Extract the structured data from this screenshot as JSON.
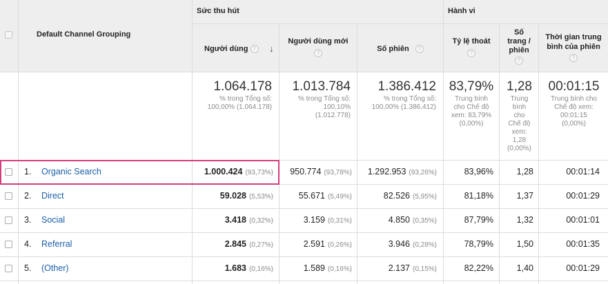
{
  "header": {
    "dimension_label": "Default Channel Grouping",
    "group_acquisition": "Sức thu hút",
    "group_behavior": "Hành vi",
    "help_glyph": "?",
    "sort_glyph": "↓",
    "columns": {
      "users": "Người dùng",
      "new_users": "Người dùng mới",
      "sessions": "Số phiên",
      "bounce_rate": "Tỷ lệ thoát",
      "pages_per_session_l1": "Số",
      "pages_per_session_l2": "trang /",
      "pages_per_session_l3": "phiên",
      "avg_duration_l1": "Thời gian trung",
      "avg_duration_l2": "bình của phiên"
    }
  },
  "totals": {
    "users": {
      "value": "1.064.178",
      "sub1": "% trong Tổng số:",
      "sub2": "100,00% (1.064.178)"
    },
    "new_users": {
      "value": "1.013.784",
      "sub1": "% trong Tổng số:",
      "sub2": "100,10%",
      "sub3": "(1.012.778)"
    },
    "sessions": {
      "value": "1.386.412",
      "sub1": "% trong Tổng số:",
      "sub2": "100,00% (1.386.412)"
    },
    "bounce_rate": {
      "value": "83,79%",
      "sub1": "Trung bình",
      "sub2": "cho Chế độ",
      "sub3": "xem: 83,79%",
      "sub4": "(0,00%)"
    },
    "pages_per_session": {
      "value": "1,28",
      "sub1": "Trung",
      "sub2": "bình",
      "sub3": "cho",
      "sub4": "Chế độ",
      "sub5": "xem:",
      "sub6": "1,28",
      "sub7": "(0,00%)"
    },
    "avg_duration": {
      "value": "00:01:15",
      "sub1": "Trung bình cho",
      "sub2": "Chế độ xem:",
      "sub3": "00:01:15",
      "sub4": "(0,00%)"
    }
  },
  "rows": [
    {
      "num": "1.",
      "channel": "Organic Search",
      "users": "1.000.424",
      "users_pct": "(93,73%)",
      "new_users": "950.774",
      "new_users_pct": "(93,78%)",
      "sessions": "1.292.953",
      "sessions_pct": "(93,26%)",
      "bounce": "83,96%",
      "pages": "1,28",
      "duration": "00:01:14"
    },
    {
      "num": "2.",
      "channel": "Direct",
      "users": "59.028",
      "users_pct": "(5,53%)",
      "new_users": "55.671",
      "new_users_pct": "(5,49%)",
      "sessions": "82.526",
      "sessions_pct": "(5,95%)",
      "bounce": "81,18%",
      "pages": "1,37",
      "duration": "00:01:29"
    },
    {
      "num": "3.",
      "channel": "Social",
      "users": "3.418",
      "users_pct": "(0,32%)",
      "new_users": "3.159",
      "new_users_pct": "(0,31%)",
      "sessions": "4.850",
      "sessions_pct": "(0,35%)",
      "bounce": "87,79%",
      "pages": "1,32",
      "duration": "00:01:01"
    },
    {
      "num": "4.",
      "channel": "Referral",
      "users": "2.845",
      "users_pct": "(0,27%)",
      "new_users": "2.591",
      "new_users_pct": "(0,26%)",
      "sessions": "3.946",
      "sessions_pct": "(0,28%)",
      "bounce": "78,79%",
      "pages": "1,50",
      "duration": "00:01:35"
    },
    {
      "num": "5.",
      "channel": "(Other)",
      "users": "1.683",
      "users_pct": "(0,16%)",
      "new_users": "1.589",
      "new_users_pct": "(0,16%)",
      "sessions": "2.137",
      "sessions_pct": "(0,15%)",
      "bounce": "82,22%",
      "pages": "1,40",
      "duration": "00:01:29"
    }
  ],
  "colors": {
    "link": "#1a5ea8",
    "highlight": "#d43b7a",
    "header_bg": "#eeeeee"
  }
}
